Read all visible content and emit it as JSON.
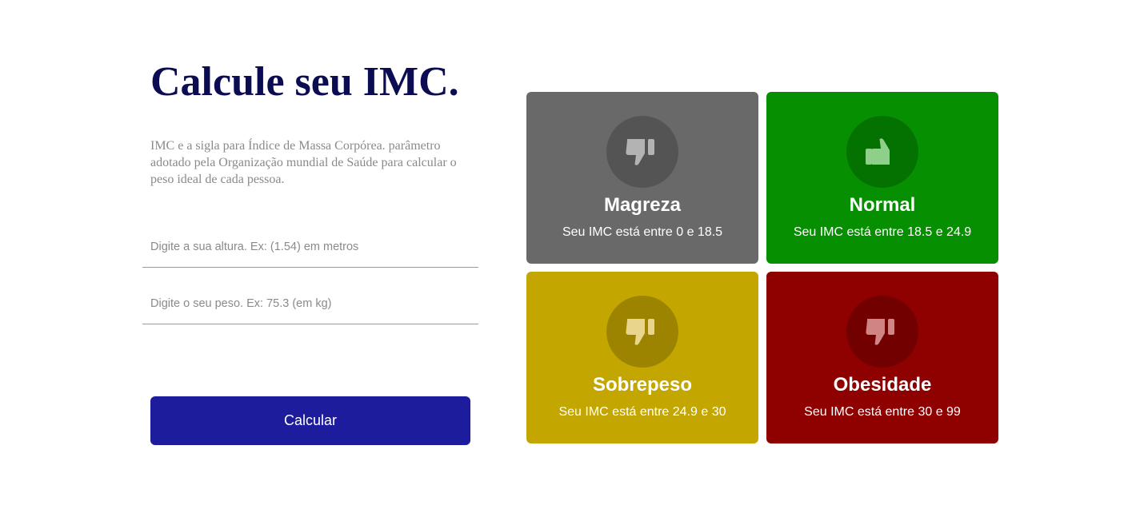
{
  "title": "Calcule seu IMC.",
  "description": "IMC e a sigla para Índice de Massa Corpórea. parâmetro adotado pela Organização mundial de Saúde para calcular o peso ideal de cada pessoa.",
  "form": {
    "altura_placeholder": "Digite a sua altura. Ex: (1.54) em metros",
    "peso_placeholder": "Digite o seu peso. Ex: 75.3 (em kg)",
    "button_label": "Calcular"
  },
  "levels": [
    {
      "title": "Magreza",
      "info": "Seu IMC está entre 0 e 18.5",
      "color": "#696969",
      "icon": "thumbs-down-icon",
      "icon_color": "#b3b3b3"
    },
    {
      "title": "Normal",
      "info": "Seu IMC está entre 18.5 e 24.9",
      "color": "#068f00",
      "icon": "thumbs-up-icon",
      "icon_color": "#8ed08a"
    },
    {
      "title": "Sobrepeso",
      "info": "Seu IMC está entre 24.9 e 30",
      "color": "#c4a600",
      "icon": "thumbs-down-icon",
      "icon_color": "#e9d68c"
    },
    {
      "title": "Obesidade",
      "info": "Seu IMC está entre 30 e 99",
      "color": "#8f0000",
      "icon": "thumbs-down-icon",
      "icon_color": "#d08484"
    }
  ]
}
